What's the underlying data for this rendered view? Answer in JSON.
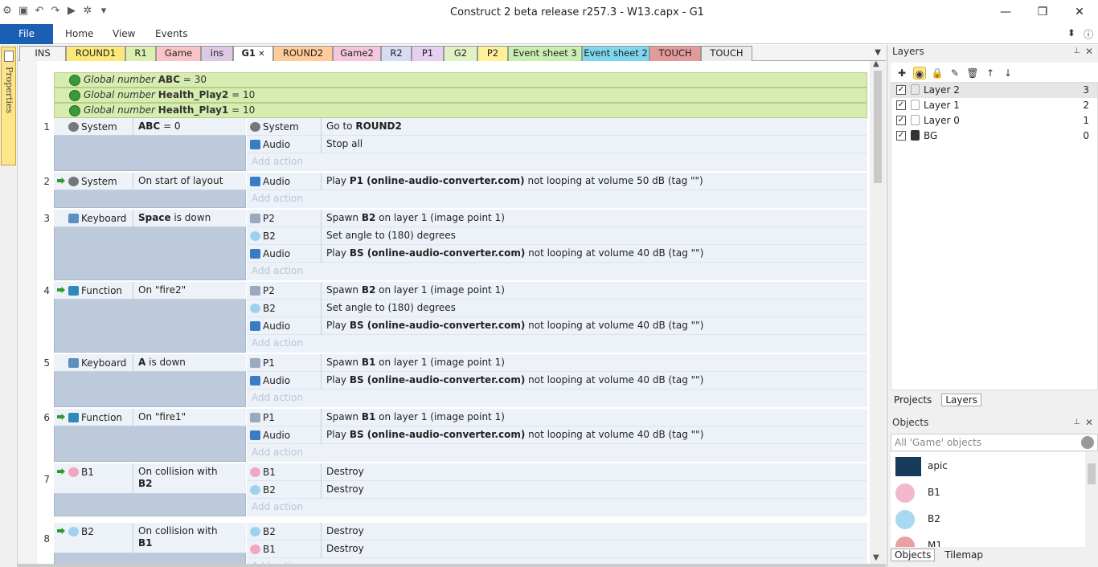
{
  "window": {
    "title": "Construct 2 beta release r257.3 - W13.capx - G1"
  },
  "ribbon": {
    "file": "File",
    "tabs": [
      "Home",
      "View",
      "Events"
    ]
  },
  "left_panel": {
    "properties": "Properties"
  },
  "tabs": [
    {
      "label": "INS",
      "color": "#f3f3f3"
    },
    {
      "label": "ROUND1",
      "color": "#fce97a"
    },
    {
      "label": "R1",
      "color": "#d9f0b0"
    },
    {
      "label": "Game",
      "color": "#f9c3c7"
    },
    {
      "label": "ins",
      "color": "#ddc8e6"
    },
    {
      "label": "G1",
      "color": "#ffffff"
    },
    {
      "label": "ROUND2",
      "color": "#ffcc99"
    },
    {
      "label": "Game2",
      "color": "#f3c7dd"
    },
    {
      "label": "R2",
      "color": "#d8dcf3"
    },
    {
      "label": "P1",
      "color": "#e5d0ef"
    },
    {
      "label": "G2",
      "color": "#e3f2c4"
    },
    {
      "label": "P2",
      "color": "#fff09a"
    },
    {
      "label": "Event sheet 3",
      "color": "#c8efb0"
    },
    {
      "label": "Event sheet 2",
      "color": "#7fd7ee"
    },
    {
      "label": "TOUCH",
      "color": "#e39a9a"
    },
    {
      "label": "TOUCH",
      "color": "#ebebeb"
    }
  ],
  "globals": [
    {
      "prefix": "Global number",
      "name": "ABC",
      "value": "= 30"
    },
    {
      "prefix": "Global number",
      "name": "Health_Play2",
      "value": "= 10"
    },
    {
      "prefix": "Global number",
      "name": "Health_Play1",
      "value": "= 10"
    }
  ],
  "add_action": "Add action",
  "events": [
    {
      "num": "1",
      "cond_obj": "System",
      "cond_icon": "gear",
      "cond_text_bold": "ABC",
      "cond_text_rest": " = 0",
      "arrow": false,
      "actions": [
        {
          "obj": "System",
          "icon": "gear",
          "text": "Go to ",
          "bold": "ROUND2",
          "rest": ""
        },
        {
          "obj": "Audio",
          "icon": "aud",
          "text": "Stop all",
          "bold": "",
          "rest": ""
        }
      ]
    },
    {
      "num": "2",
      "cond_obj": "System",
      "cond_icon": "gear",
      "cond_text_bold": "",
      "cond_text_rest": "On start of layout",
      "arrow": true,
      "actions": [
        {
          "obj": "Audio",
          "icon": "aud",
          "text": "Play ",
          "bold": "P1 (online-audio-converter.com)",
          "rest": " not looping at volume 50 dB (tag \"\")"
        }
      ]
    },
    {
      "num": "3",
      "cond_obj": "Keyboard",
      "cond_icon": "kbd",
      "cond_text_bold": "Space",
      "cond_text_rest": " is down",
      "arrow": false,
      "actions": [
        {
          "obj": "P2",
          "icon": "spr",
          "text": "Spawn ",
          "bold": "B2",
          "rest": " on layer 1 (image point 1)"
        },
        {
          "obj": "B2",
          "icon": "blue",
          "text": "Set angle to (180) degrees",
          "bold": "",
          "rest": ""
        },
        {
          "obj": "Audio",
          "icon": "aud",
          "text": "Play ",
          "bold": "BS (online-audio-converter.com)",
          "rest": " not looping at volume 40 dB (tag \"\")"
        }
      ]
    },
    {
      "num": "4",
      "cond_obj": "Function",
      "cond_icon": "fn",
      "cond_text_bold": "",
      "cond_text_rest": "On \"fire2\"",
      "arrow": true,
      "actions": [
        {
          "obj": "P2",
          "icon": "spr",
          "text": "Spawn ",
          "bold": "B2",
          "rest": " on layer 1 (image point 1)"
        },
        {
          "obj": "B2",
          "icon": "blue",
          "text": "Set angle to (180) degrees",
          "bold": "",
          "rest": ""
        },
        {
          "obj": "Audio",
          "icon": "aud",
          "text": "Play ",
          "bold": "BS (online-audio-converter.com)",
          "rest": " not looping at volume 40 dB (tag \"\")"
        }
      ]
    },
    {
      "num": "5",
      "cond_obj": "Keyboard",
      "cond_icon": "kbd",
      "cond_text_bold": "A",
      "cond_text_rest": " is down",
      "arrow": false,
      "actions": [
        {
          "obj": "P1",
          "icon": "spr",
          "text": "Spawn ",
          "bold": "B1",
          "rest": " on layer 1 (image point 1)"
        },
        {
          "obj": "Audio",
          "icon": "aud",
          "text": "Play ",
          "bold": "BS (online-audio-converter.com)",
          "rest": " not looping at volume 40 dB (tag \"\")"
        }
      ]
    },
    {
      "num": "6",
      "cond_obj": "Function",
      "cond_icon": "fn",
      "cond_text_bold": "",
      "cond_text_rest": "On \"fire1\"",
      "arrow": true,
      "actions": [
        {
          "obj": "P1",
          "icon": "spr",
          "text": "Spawn ",
          "bold": "B1",
          "rest": " on layer 1 (image point 1)"
        },
        {
          "obj": "Audio",
          "icon": "aud",
          "text": "Play ",
          "bold": "BS (online-audio-converter.com)",
          "rest": " not looping at volume 40 dB (tag \"\")"
        }
      ]
    },
    {
      "num": "7",
      "cond_obj": "B1",
      "cond_icon": "pink",
      "cond_text_bold": "B2",
      "cond_text_rest": "On collision with",
      "arrow": true,
      "actions": [
        {
          "obj": "B1",
          "icon": "pink",
          "text": "Destroy",
          "bold": "",
          "rest": ""
        },
        {
          "obj": "B2",
          "icon": "blue",
          "text": "Destroy",
          "bold": "",
          "rest": ""
        }
      ]
    },
    {
      "num": "8",
      "cond_obj": "B2",
      "cond_icon": "blue",
      "cond_text_bold": "B1",
      "cond_text_rest": "On collision with",
      "arrow": true,
      "actions": [
        {
          "obj": "B2",
          "icon": "blue",
          "text": "Destroy",
          "bold": "",
          "rest": ""
        },
        {
          "obj": "B1",
          "icon": "pink",
          "text": "Destroy",
          "bold": "",
          "rest": ""
        }
      ]
    }
  ],
  "layers_panel": {
    "title": "Layers",
    "layers": [
      {
        "name": "Layer 2",
        "num": "3",
        "locked": false
      },
      {
        "name": "Layer 1",
        "num": "2",
        "locked": false
      },
      {
        "name": "Layer 0",
        "num": "1",
        "locked": false
      },
      {
        "name": "BG",
        "num": "0",
        "locked": true
      }
    ],
    "tabs": [
      "Projects",
      "Layers"
    ]
  },
  "objects_panel": {
    "title": "Objects",
    "filter": "All 'Game' objects",
    "items": [
      "apic",
      "B1",
      "B2",
      "M1"
    ],
    "tabs": [
      "Objects",
      "Tilemap"
    ]
  }
}
